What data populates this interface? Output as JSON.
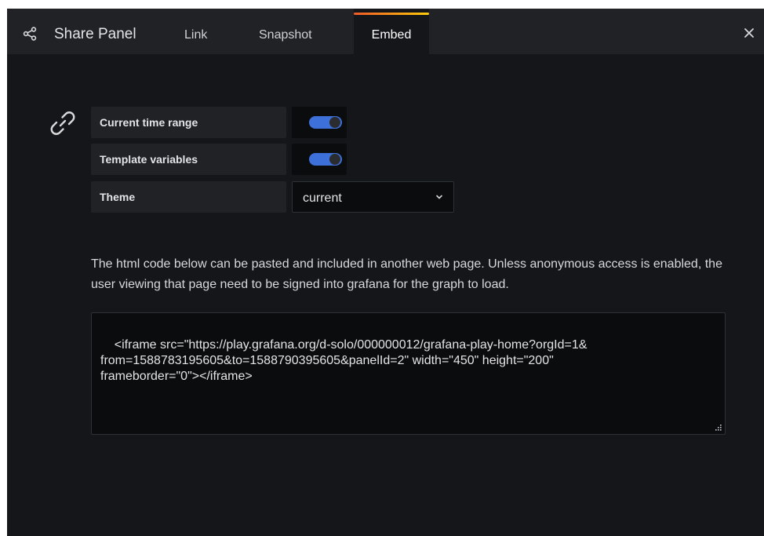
{
  "header": {
    "title": "Share Panel",
    "icon": "share-icon",
    "tabs": [
      {
        "label": "Link",
        "active": false
      },
      {
        "label": "Snapshot",
        "active": false
      },
      {
        "label": "Embed",
        "active": true
      }
    ],
    "close_icon": "close-icon"
  },
  "options": {
    "current_time_range": {
      "label": "Current time range",
      "enabled": true
    },
    "template_variables": {
      "label": "Template variables",
      "enabled": true
    },
    "theme": {
      "label": "Theme",
      "value": "current"
    }
  },
  "description": "The html code below can be pasted and included in another web page. Unless anonymous access is enabled, the user viewing that page need to be signed into grafana for the graph to load.",
  "embed_code": "<iframe src=\"https://play.grafana.org/d-solo/000000012/grafana-play-home?orgId=1&\nfrom=1588783195605&to=1588790395605&panelId=2\" width=\"450\" height=\"200\"\nframeborder=\"0\"></iframe>",
  "colors": {
    "accent_toggle": "#3d71d9",
    "tab_gradient_start": "#f05a28",
    "tab_gradient_end": "#fbca0a",
    "background": "#141619",
    "header": "#202226"
  }
}
